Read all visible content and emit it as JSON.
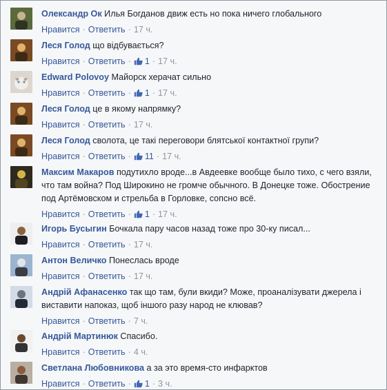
{
  "actions": {
    "like": "Нравится",
    "reply": "Ответить",
    "separator": "·"
  },
  "comments": [
    {
      "author": "Олександр Ок",
      "text": "Илья Богданов движ есть но пока ничего глобального",
      "time": "17 ч.",
      "likes": ""
    },
    {
      "author": "Леся Голод",
      "text": "що відбувається?",
      "time": "17 ч.",
      "likes": "1"
    },
    {
      "author": "Edward Polovoy",
      "text": "Майорск херачат сильно",
      "time": "17 ч.",
      "likes": "1"
    },
    {
      "author": "Леся Голод",
      "text": "це в якому напрямку?",
      "time": "17 ч.",
      "likes": ""
    },
    {
      "author": "Леся Голод",
      "text": "сволота, це такі переговори блятської контактної групи?",
      "time": "17 ч.",
      "likes": "11"
    },
    {
      "author": "Максим Макаров",
      "text": "подутихло вроде...в Авдеевке вообще было тихо, с чего взяли, что там война? Под Широкино не громче обычного. В Донецке тоже. Обострение под Артёмовском и стрельба в Горловке, сопсно всё.",
      "time": "17 ч.",
      "likes": "1"
    },
    {
      "author": "Игорь Бусыгин",
      "text": "Бочкала пару часов назад тоже про 30-ку писал...",
      "time": "17 ч.",
      "likes": ""
    },
    {
      "author": "Антон Величко",
      "text": "Понеслась вроде",
      "time": "17 ч.",
      "likes": ""
    },
    {
      "author": "Андрій Афанасенко",
      "text": "так що там, були вкиди? Може, проаналізувати джерела і виставити напоказ, щоб іншого разу народ не клював?",
      "time": "7 ч.",
      "likes": ""
    },
    {
      "author": "Андрій Мартинюк",
      "text": "Спасибо.",
      "time": "4 ч.",
      "likes": ""
    },
    {
      "author": "Светлана Любовникова",
      "text": "а за это время-сто инфарктов",
      "time": "3 ч.",
      "likes": "1"
    }
  ],
  "avatars": [
    "photo",
    "photo",
    "cat-photo",
    "photo",
    "photo",
    "photo",
    "photo",
    "photo",
    "photo",
    "photo",
    "photo"
  ],
  "colors": {
    "link": "#365899",
    "text": "#1d2129",
    "muted": "#90949c",
    "background": "#f6f7f9",
    "like_blue": "#4267b2"
  }
}
